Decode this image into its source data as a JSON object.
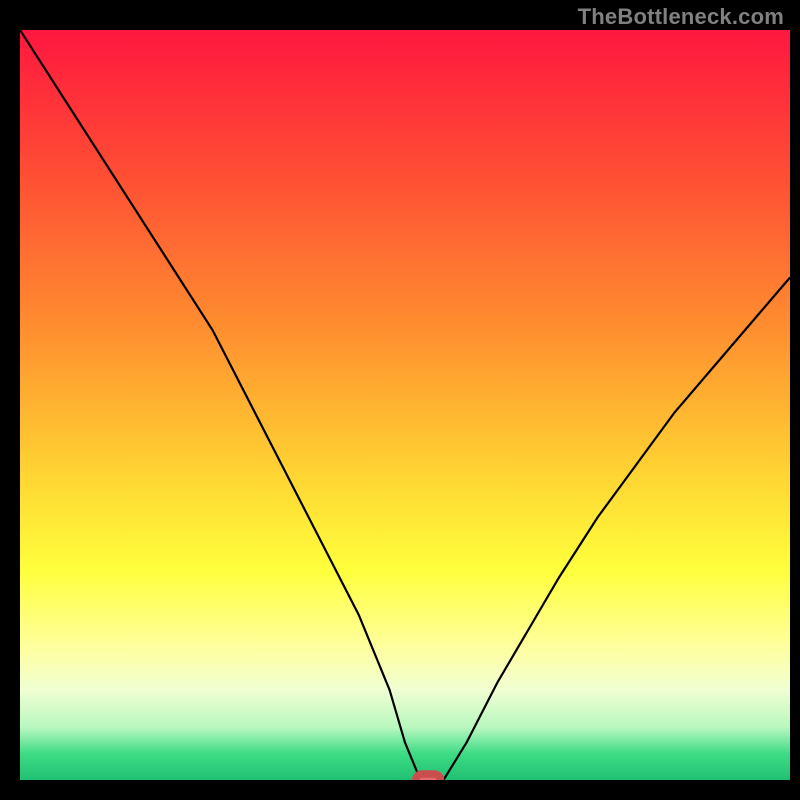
{
  "watermark": "TheBottleneck.com",
  "chart_data": {
    "type": "line",
    "title": "",
    "xlabel": "",
    "ylabel": "",
    "xlim": [
      0,
      100
    ],
    "ylim": [
      0,
      100
    ],
    "grid": false,
    "legend": false,
    "background_gradient": {
      "stops": [
        {
          "offset": 0.0,
          "color": "#ff173f"
        },
        {
          "offset": 0.2,
          "color": "#ff5034"
        },
        {
          "offset": 0.4,
          "color": "#ff8f2f"
        },
        {
          "offset": 0.6,
          "color": "#ffd733"
        },
        {
          "offset": 0.72,
          "color": "#ffff3c"
        },
        {
          "offset": 0.82,
          "color": "#ffff9c"
        },
        {
          "offset": 0.88,
          "color": "#f0ffd2"
        },
        {
          "offset": 0.93,
          "color": "#b8f7bf"
        },
        {
          "offset": 0.965,
          "color": "#3ddc84"
        },
        {
          "offset": 1.0,
          "color": "#20c073"
        }
      ]
    },
    "series": [
      {
        "name": "bottleneck-curve",
        "x": [
          0,
          5,
          10,
          15,
          20,
          25,
          28,
          32,
          36,
          40,
          44,
          48,
          50,
          52,
          54,
          55,
          58,
          62,
          66,
          70,
          75,
          80,
          85,
          90,
          95,
          100
        ],
        "y": [
          100,
          92,
          84,
          76,
          68,
          60,
          54,
          46,
          38,
          30,
          22,
          12,
          5,
          0,
          0,
          0,
          5,
          13,
          20,
          27,
          35,
          42,
          49,
          55,
          61,
          67
        ]
      }
    ],
    "marker": {
      "name": "optimal-point",
      "x": 53,
      "y": 0,
      "width": 3.2,
      "height": 1.6,
      "color": "#e66a6a"
    }
  }
}
